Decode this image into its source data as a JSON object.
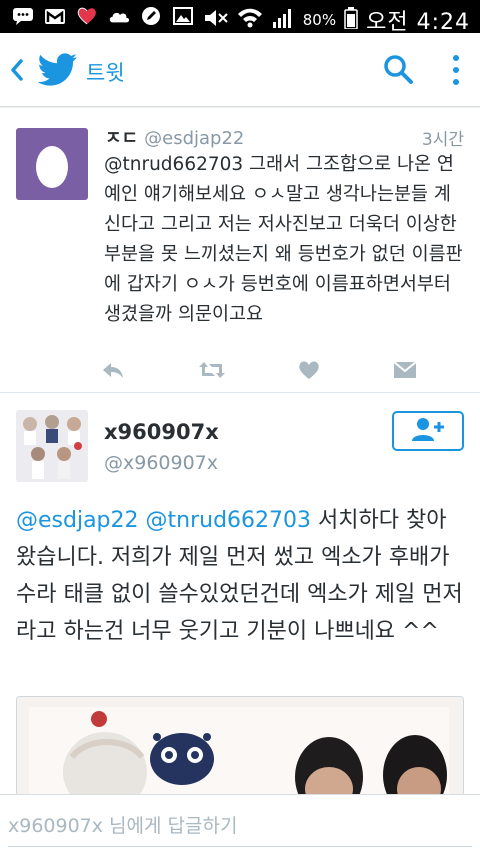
{
  "status_bar": {
    "battery": "80%",
    "time": "오전 4:24",
    "icons": [
      "chat-icon",
      "gmail-icon",
      "heart-app-icon",
      "cloud-icon",
      "pen-icon",
      "image-icon",
      "mute-icon",
      "wifi-icon",
      "signal-icon",
      "battery-icon"
    ]
  },
  "app_bar": {
    "title": "트윗",
    "brand_color": "#1b95e0",
    "icons": [
      "back-icon",
      "twitter-bird-icon",
      "search-icon",
      "more-vert-icon"
    ]
  },
  "reply_tweet": {
    "name": "ㅈㄷ",
    "handle": "@esdjap22",
    "time": "3시간",
    "text": "@tnrud662703 그래서 그조합으로 나온 연예인 얘기해보세요 ㅇㅅ말고 생각나는분들 계신다고 그리고 저는 저사진보고 더욱더 이상한 부분을 못 느끼셨는지 왜 등번호가 없던 이름판에 갑자기 ㅇㅅ가 등번호에 이름표하면서부터 생겼을까 의문이고요",
    "actions": [
      "reply-icon",
      "retweet-icon",
      "like-icon",
      "dm-icon"
    ]
  },
  "main_tweet": {
    "name": "x960907x",
    "handle": "@x960907x",
    "mention1": "@esdjap22",
    "mention2": "@tnrud662703",
    "text": "서치하다 찾아왔습니다. 저희가 제일 먼저 썼고 엑소가 후배가수라 태클 없이 쓸수있었던건데 엑소가 제일 먼저라고 하는건 너무 웃기고 기분이 나쁘네요 ^^",
    "follow_icon": "follow-user-icon"
  },
  "compose": {
    "placeholder": "x960907x 님에게 답글하기"
  }
}
